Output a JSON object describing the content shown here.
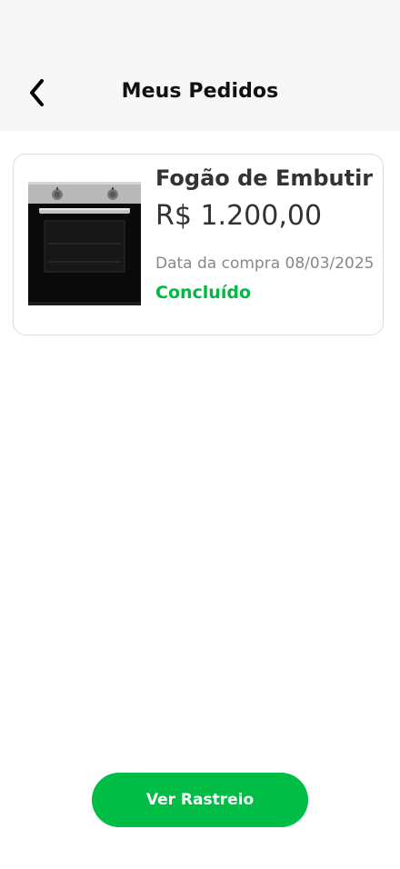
{
  "header": {
    "title": "Meus Pedidos",
    "back_icon": "chevron-left-icon"
  },
  "orders": [
    {
      "product_name": "Fogão de Embutir",
      "price": "R$ 1.200,00",
      "purchase_date": "Data da compra 08/03/2025",
      "status": "Concluído",
      "image_icon": "built-in-oven-image"
    }
  ],
  "actions": {
    "track_label": "Ver Rastreio"
  },
  "colors": {
    "header_bg": "#f7f7f7",
    "accent_green": "#00bd45",
    "status_green": "#00b843",
    "text_dark": "#333333",
    "text_muted": "#888888",
    "card_border": "#dddddd"
  }
}
